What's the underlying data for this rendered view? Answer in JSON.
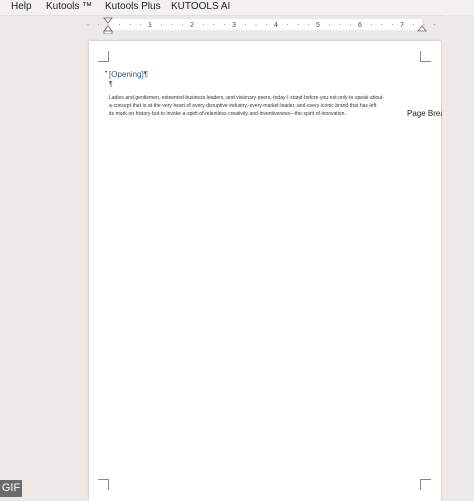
{
  "menu": {
    "items": [
      "Help",
      "Kutools ™",
      "Kutools Plus",
      "KUTOOLS AI"
    ]
  },
  "ruler": {
    "numbers": [
      "1",
      "2",
      "3",
      "4",
      "5",
      "6",
      "7"
    ]
  },
  "document": {
    "heading": "[Opening]¶",
    "empty_paragraph": "¶",
    "body_lines": [
      "Ladies·and·gentlemen,·esteemed·business·leaders,·and·visionary·peers,·today·I·stand·before·you·not·only·to·speak·about·",
      "a·concept·that·is·at·the·very·heart·of·every·disruptive·industry,·every·market·leader,·and·every·iconic·brand·that·has·left·",
      "its·mark·on·history·but·to·invoke·a·spirit·of·relentless·creativity·and·inventiveness—the·spirit·of·innovation.·"
    ],
    "page_break_label": "Page Brea"
  },
  "badge": "GIF"
}
